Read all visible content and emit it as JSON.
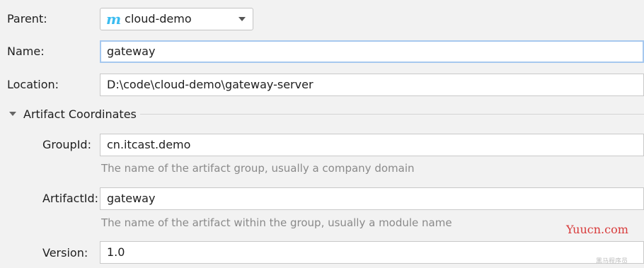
{
  "form": {
    "parent_label": "Parent:",
    "parent_value": "cloud-demo",
    "parent_icon": "maven-m-icon",
    "name_label": "Name:",
    "name_value": "gateway",
    "location_label": "Location:",
    "location_value": "D:\\code\\cloud-demo\\gateway-server"
  },
  "artifact": {
    "section_title": "Artifact Coordinates",
    "groupid_label": "GroupId:",
    "groupid_value": "cn.itcast.demo",
    "groupid_hint": "The name of the artifact group, usually a company domain",
    "artifactid_label": "ArtifactId:",
    "artifactid_value": "gateway",
    "artifactid_hint": "The name of the artifact within the group, usually a module name",
    "version_label": "Version:",
    "version_value": "1.0"
  },
  "watermark": {
    "text": "Yuucn.com",
    "small_text": "黑马程序员"
  },
  "colors": {
    "focus_border": "#a6c8ef",
    "maven_icon": "#3bbcf0",
    "watermark": "#d83a3a"
  }
}
